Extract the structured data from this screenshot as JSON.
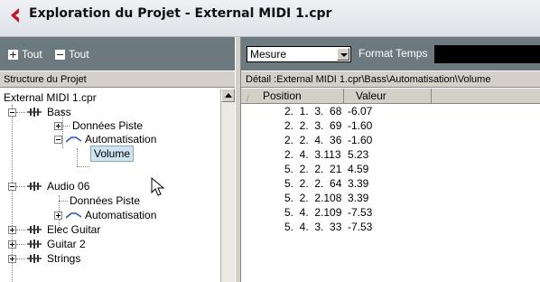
{
  "window": {
    "title": "Exploration du Projet - External MIDI 1.cpr"
  },
  "left_toolbar": {
    "expand_all_label": "Tout",
    "collapse_all_label": "Tout"
  },
  "left_panel": {
    "header": "Structure du Projet"
  },
  "tree": {
    "root": "External MIDI 1.cpr",
    "nodes": [
      {
        "label": "Bass"
      },
      {
        "label": "Données Piste"
      },
      {
        "label": "Automatisation"
      },
      {
        "label": "Volume"
      },
      {
        "label": "Audio 06"
      },
      {
        "label": "Données Piste"
      },
      {
        "label": "Automatisation"
      },
      {
        "label": "Elec Guitar"
      },
      {
        "label": "Guitar 2"
      },
      {
        "label": "Strings"
      }
    ]
  },
  "right_toolbar": {
    "display_format_value": "Mesure",
    "time_format_label": "Format Temps"
  },
  "detail": {
    "path": "Détail :External MIDI 1.cpr\\Bass\\Automatisation\\Volume"
  },
  "table": {
    "columns": [
      "Position",
      "Valeur"
    ],
    "rows": [
      {
        "position": "2.  1.  3.  68",
        "value": "-6.07"
      },
      {
        "position": "2.  2.  3.  69",
        "value": "-1.60"
      },
      {
        "position": "2.  2.  4.  36",
        "value": "-1.60"
      },
      {
        "position": "2.  4.  3.113",
        "value": "5.23"
      },
      {
        "position": "5.  2.  2.  21",
        "value": "4.59"
      },
      {
        "position": "5.  2.  2.  64",
        "value": "3.39"
      },
      {
        "position": "5.  2.  2.108",
        "value": "3.39"
      },
      {
        "position": "5.  4.  2.109",
        "value": "-7.53"
      },
      {
        "position": "5.  4.  3.  33",
        "value": "-7.53"
      }
    ]
  },
  "colors": {
    "toolbar_bg": "#6c7a80",
    "logo_red": "#c8141e",
    "automation_blue": "#2050d8",
    "selection_bg": "#cfe3f0"
  },
  "icons": [
    "app-logo-icon",
    "track-icon",
    "automation-icon",
    "sort-icon",
    "mouse-cursor-icon"
  ]
}
